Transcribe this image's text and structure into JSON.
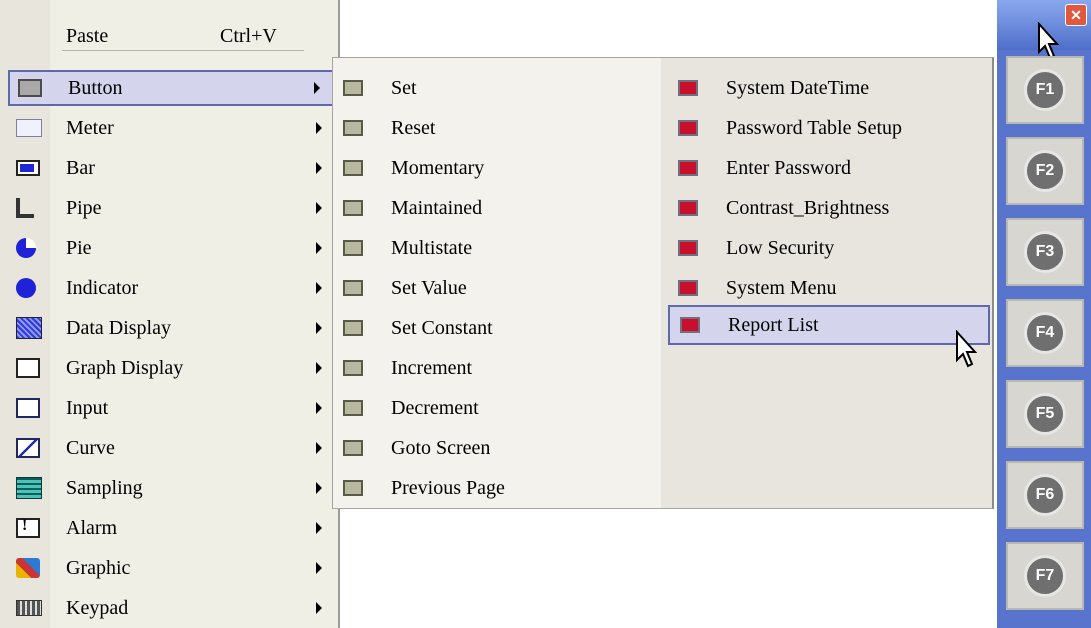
{
  "menu1": {
    "paste": {
      "label": "Paste",
      "shortcut": "Ctrl+V"
    },
    "items": [
      {
        "label": "Button",
        "icon": "button-icon"
      },
      {
        "label": "Meter",
        "icon": "meter-icon"
      },
      {
        "label": "Bar",
        "icon": "bar-icon"
      },
      {
        "label": "Pipe",
        "icon": "pipe-icon"
      },
      {
        "label": "Pie",
        "icon": "pie-icon"
      },
      {
        "label": "Indicator",
        "icon": "indicator-icon"
      },
      {
        "label": "Data Display",
        "icon": "data-display-icon"
      },
      {
        "label": "Graph Display",
        "icon": "graph-display-icon"
      },
      {
        "label": "Input",
        "icon": "input-icon"
      },
      {
        "label": "Curve",
        "icon": "curve-icon"
      },
      {
        "label": "Sampling",
        "icon": "sampling-icon"
      },
      {
        "label": "Alarm",
        "icon": "alarm-icon"
      },
      {
        "label": "Graphic",
        "icon": "graphic-icon"
      },
      {
        "label": "Keypad",
        "icon": "keypad-icon"
      }
    ]
  },
  "menu2": {
    "items": [
      "Set",
      "Reset",
      "Momentary",
      "Maintained",
      "Multistate",
      "Set Value",
      "Set Constant",
      "Increment",
      "Decrement",
      "Goto Screen",
      "Previous Page"
    ]
  },
  "menu3": {
    "items": [
      "System DateTime",
      "Password Table Setup",
      "Enter Password",
      "Contrast_Brightness",
      "Low Security",
      "System Menu",
      "Report List"
    ]
  },
  "fkeys": [
    "F1",
    "F2",
    "F3",
    "F4",
    "F5",
    "F6",
    "F7"
  ],
  "colors": {
    "highlight": "#d4d5ec",
    "highlight_border": "#5d68ad",
    "panel": "#5874cc"
  }
}
